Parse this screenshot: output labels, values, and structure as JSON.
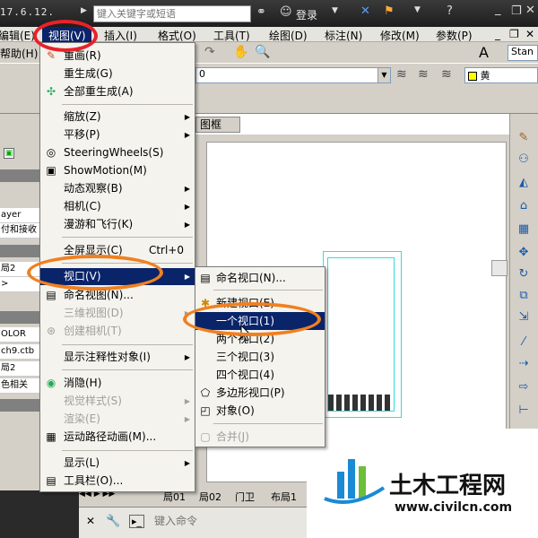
{
  "title": {
    "text": "17.6.12.",
    "search_placeholder": "键入关键字或短语",
    "login": "登录"
  },
  "menubar": {
    "items": [
      {
        "label": "编辑(E)"
      },
      {
        "label": "视图(V)"
      },
      {
        "label": "插入(I)"
      },
      {
        "label": "格式(O)"
      },
      {
        "label": "工具(T)"
      },
      {
        "label": "绘图(D)"
      },
      {
        "label": "标注(N)"
      },
      {
        "label": "修改(M)"
      },
      {
        "label": "参数(P)"
      }
    ],
    "help": "帮助(H)"
  },
  "toolbar": {
    "layer_value": "0",
    "color_value": "黄",
    "style_value": "Stan"
  },
  "left_panel": {
    "rows": [
      "ayer",
      "付和接收",
      "局2",
      "OLOR",
      "ch9.ctb",
      "局2",
      "色相关"
    ]
  },
  "drawing": {
    "tab_label": "图框"
  },
  "view_menu": {
    "items": [
      {
        "label": "重画(R)",
        "icon": "pencil-icon"
      },
      {
        "label": "重生成(G)"
      },
      {
        "label": "全部重生成(A)",
        "icon": "regen-all-icon"
      },
      {
        "label": "缩放(Z)",
        "submenu": true
      },
      {
        "label": "平移(P)",
        "submenu": true
      },
      {
        "label": "SteeringWheels(S)",
        "icon": "steeringwheel-icon"
      },
      {
        "label": "ShowMotion(M)",
        "icon": "showmotion-icon"
      },
      {
        "label": "动态观察(B)",
        "submenu": true
      },
      {
        "label": "相机(C)",
        "submenu": true
      },
      {
        "label": "漫游和飞行(K)",
        "submenu": true
      },
      {
        "label": "全屏显示(C)",
        "shortcut": "Ctrl+0"
      },
      {
        "label": "视口(V)",
        "submenu": true,
        "highlighted": true
      },
      {
        "label": "命名视图(N)...",
        "icon": "named-view-icon"
      },
      {
        "label": "三维视图(D)",
        "submenu": true,
        "disabled": true
      },
      {
        "label": "创建相机(T)",
        "icon": "camera-icon",
        "disabled": true
      },
      {
        "label": "显示注释性对象(I)",
        "submenu": true
      },
      {
        "label": "消隐(H)",
        "icon": "hide-icon"
      },
      {
        "label": "视觉样式(S)",
        "submenu": true,
        "disabled": true
      },
      {
        "label": "渲染(E)",
        "submenu": true,
        "disabled": true
      },
      {
        "label": "运动路径动画(M)...",
        "icon": "motion-path-icon"
      },
      {
        "label": "显示(L)",
        "submenu": true
      },
      {
        "label": "工具栏(O)...",
        "icon": "toolbar-icon"
      }
    ]
  },
  "viewports_menu": {
    "items": [
      {
        "label": "命名视口(N)..."
      },
      {
        "label": "新建视口(E)..."
      },
      {
        "label": "一个视口(1)",
        "highlighted": true
      },
      {
        "label": "两个视口(2)"
      },
      {
        "label": "三个视口(3)"
      },
      {
        "label": "四个视口(4)"
      },
      {
        "label": "多边形视口(P)"
      },
      {
        "label": "对象(O)"
      },
      {
        "label": "合并(J)",
        "disabled": true
      }
    ]
  },
  "layout_tabs": [
    "局01",
    "局02",
    "门卫",
    "布局1"
  ],
  "command": {
    "placeholder": "键入命令"
  },
  "colors": {
    "highlight": "#0a246a",
    "annotation_red": "#e8222a",
    "annotation_orange": "#f08020"
  }
}
